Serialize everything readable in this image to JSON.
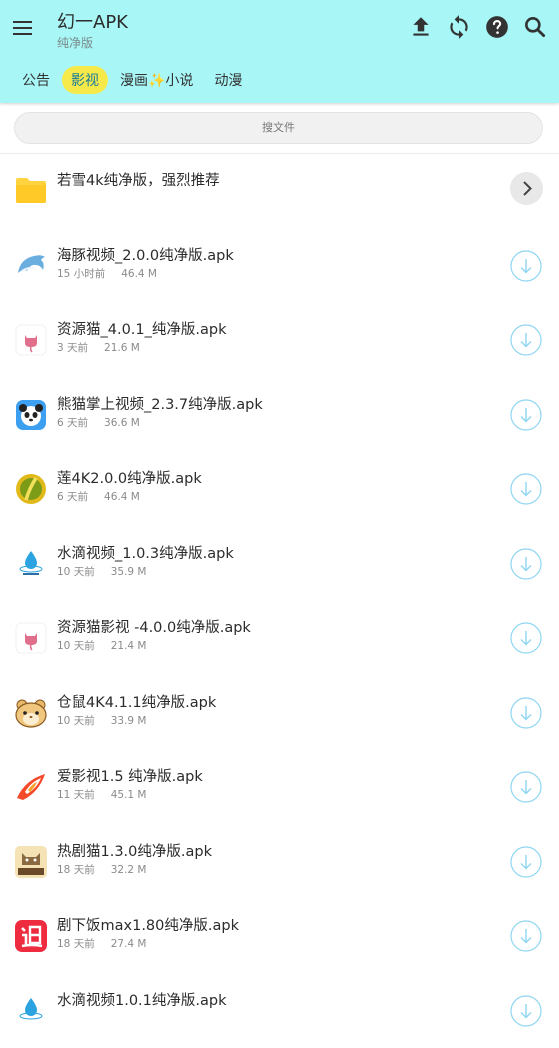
{
  "app": {
    "title": "幻一APK",
    "subtitle": "纯净版"
  },
  "toolbar": {
    "menu_icon": "menu-icon",
    "upload_icon": "upload-icon",
    "refresh_icon": "refresh-icon",
    "help_icon": "help-icon",
    "search_icon": "search-icon"
  },
  "tabs": [
    {
      "label": "公告",
      "active": false
    },
    {
      "label": "影视",
      "active": true
    },
    {
      "label": "漫画✨小说",
      "active": false
    },
    {
      "label": "动漫",
      "active": false
    }
  ],
  "search": {
    "placeholder": "搜文件"
  },
  "colors": {
    "header_bg": "#a8f6f6",
    "active_tab_bg": "#f6e94a",
    "active_tab_text": "#1a7c9a",
    "download_accent": "#8fd6f2",
    "folder": "#ffd23f"
  },
  "folder": {
    "name": "若雪4k纯净版，强烈推荐",
    "icon": "folder-icon"
  },
  "files": [
    {
      "name": "海豚视频_2.0.0纯净版.apk",
      "time": "15 小时前",
      "size": "46.4 M",
      "icon": "dolphin-icon"
    },
    {
      "name": "资源猫_4.0.1_纯净版.apk",
      "time": "3 天前",
      "size": "21.6 M",
      "icon": "cat-icon"
    },
    {
      "name": "熊猫掌上视频_2.3.7纯净版.apk",
      "time": "6 天前",
      "size": "36.6 M",
      "icon": "panda-icon"
    },
    {
      "name": "莲4K2.0.0纯净版.apk",
      "time": "6 天前",
      "size": "46.4 M",
      "icon": "durian-icon"
    },
    {
      "name": "水滴视频_1.0.3纯净版.apk",
      "time": "10 天前",
      "size": "35.9 M",
      "icon": "water-drop-icon"
    },
    {
      "name": "资源猫影视 -4.0.0纯净版.apk",
      "time": "10 天前",
      "size": "21.4 M",
      "icon": "cat-icon"
    },
    {
      "name": "仓鼠4K4.1.1纯净版.apk",
      "time": "10 天前",
      "size": "33.9 M",
      "icon": "hamster-icon"
    },
    {
      "name": "爱影视1.5 纯净版.apk",
      "time": "11 天前",
      "size": "45.1 M",
      "icon": "rocket-icon"
    },
    {
      "name": "热剧猫1.3.0纯净版.apk",
      "time": "18 天前",
      "size": "32.2 M",
      "icon": "drama-cat-icon"
    },
    {
      "name": "剧下饭max1.80纯净版.apk",
      "time": "18 天前",
      "size": "27.4 M",
      "icon": "zhui-icon"
    },
    {
      "name": "水滴视频1.0.1纯净版.apk",
      "time": "",
      "size": "",
      "icon": "water-drop-icon"
    }
  ]
}
